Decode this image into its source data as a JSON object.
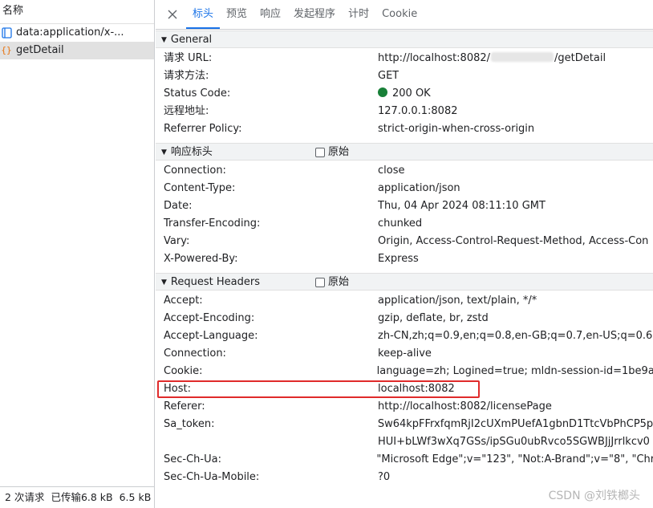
{
  "list": {
    "header": "名称",
    "items": [
      {
        "name": "data:application/x-...",
        "icon": "document-icon",
        "selected": false
      },
      {
        "name": "getDetail",
        "icon": "braces-icon",
        "selected": true
      }
    ],
    "status": {
      "requests": "2 次请求",
      "transferred": "已传输6.8 kB",
      "resources": "6.5 kB"
    }
  },
  "tabs": [
    "标头",
    "预览",
    "响应",
    "发起程序",
    "计时",
    "Cookie"
  ],
  "general": {
    "title": "General",
    "rows": [
      {
        "k": "请求 URL:",
        "v_prefix": "http://localhost:8082/",
        "v_suffix": "/getDetail"
      },
      {
        "k": "请求方法:",
        "v": "GET"
      },
      {
        "k": "Status Code:",
        "v": "200 OK"
      },
      {
        "k": "远程地址:",
        "v": "127.0.0.1:8082"
      },
      {
        "k": "Referrer Policy:",
        "v": "strict-origin-when-cross-origin"
      }
    ]
  },
  "response_headers": {
    "title": "响应标头",
    "raw_label": "原始",
    "rows": [
      {
        "k": "Connection:",
        "v": "close"
      },
      {
        "k": "Content-Type:",
        "v": "application/json"
      },
      {
        "k": "Date:",
        "v": "Thu, 04 Apr 2024 08:11:10 GMT"
      },
      {
        "k": "Transfer-Encoding:",
        "v": "chunked"
      },
      {
        "k": "Vary:",
        "v": "Origin, Access-Control-Request-Method, Access-Con"
      },
      {
        "k": "X-Powered-By:",
        "v": "Express"
      }
    ]
  },
  "request_headers": {
    "title": "Request Headers",
    "raw_label": "原始",
    "rows": [
      {
        "k": "Accept:",
        "v": "application/json, text/plain, */*"
      },
      {
        "k": "Accept-Encoding:",
        "v": "gzip, deflate, br, zstd"
      },
      {
        "k": "Accept-Language:",
        "v": "zh-CN,zh;q=0.9,en;q=0.8,en-GB;q=0.7,en-US;q=0.6"
      },
      {
        "k": "Connection:",
        "v": "keep-alive"
      },
      {
        "k": "Cookie:",
        "v": "language=zh; Logined=true; mldn-session-id=1be9a"
      },
      {
        "k": "Host:",
        "v": "localhost:8082",
        "highlight": true
      },
      {
        "k": "Referer:",
        "v": "http://localhost:8082/licensePage"
      },
      {
        "k": "Sa_token:",
        "v": "Sw64kpFFrxfqmRjI2cUXmPUefA1gbnD1TtcVbPhCP5p"
      },
      {
        "k": "",
        "v": "HUI+bLWf3wXq7GSs/ipSGu0ubRvco5SGWBJjJrrlkcv0"
      },
      {
        "k": "Sec-Ch-Ua:",
        "v": "\"Microsoft Edge\";v=\"123\", \"Not:A-Brand\";v=\"8\", \"Chr"
      },
      {
        "k": "Sec-Ch-Ua-Mobile:",
        "v": "?0"
      }
    ]
  },
  "colors": {
    "accent": "#1a73e8",
    "status_ok": "#188038",
    "highlight": "#e02b2b"
  },
  "watermark": "CSDN @刘铁榔头"
}
